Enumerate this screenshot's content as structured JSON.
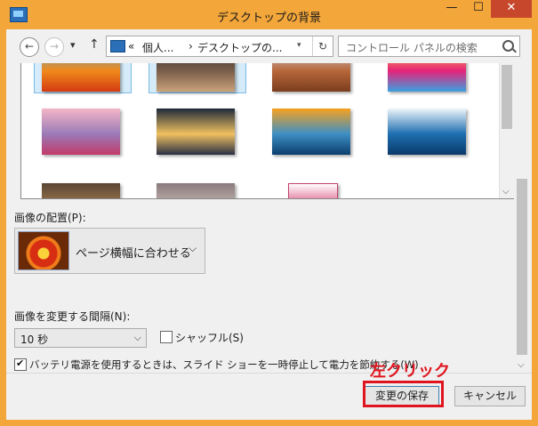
{
  "window": {
    "title": "デスクトップの背景",
    "minimize": "—",
    "maximize": "☐",
    "close": "✕"
  },
  "nav": {
    "back": "←",
    "forward": "→",
    "recent": "▾",
    "up": "↑",
    "address_prefix": "«",
    "crumb1": "個人...",
    "sep": "›",
    "crumb2": "デスクトップの...",
    "address_dropdown": "▾",
    "refresh": "↻",
    "search_placeholder": "コントロール パネルの検索"
  },
  "thumbnails": [
    {
      "name": "orange-flowers",
      "selected": true,
      "colors": [
        "#5aa7d8",
        "#f08a1a",
        "#d43a12"
      ]
    },
    {
      "name": "dark-bokeh",
      "selected": true,
      "colors": [
        "#2d2b30",
        "#7a5e4a",
        "#c9a27a"
      ]
    },
    {
      "name": "monument-valley",
      "selected": false,
      "colors": [
        "#c9d9ee",
        "#b8673a",
        "#7a3d1e"
      ]
    },
    {
      "name": "rainbow-swirl",
      "selected": false,
      "colors": [
        "#f9d63a",
        "#e6237a",
        "#3aa0e0"
      ]
    },
    {
      "name": "tulip-field",
      "selected": false,
      "colors": [
        "#f4b6c6",
        "#9a7bb8",
        "#c23a6a"
      ]
    },
    {
      "name": "city-lights-bokeh",
      "selected": false,
      "colors": [
        "#1e2a3a",
        "#f0c060",
        "#2a2f45"
      ]
    },
    {
      "name": "sunset-sea",
      "selected": false,
      "colors": [
        "#f7a21e",
        "#3e8fc4",
        "#0b3e6e"
      ]
    },
    {
      "name": "surfer-wave",
      "selected": false,
      "colors": [
        "#eef6fb",
        "#1e6eb0",
        "#0a3a6a"
      ]
    },
    {
      "name": "cat-face",
      "selected": false,
      "colors": [
        "#5a4634",
        "#a67c52",
        "#2a2018"
      ]
    },
    {
      "name": "blurry-dusk",
      "selected": false,
      "colors": [
        "#8a7b80",
        "#c9b8b0",
        "#4a3e44"
      ]
    },
    {
      "name": "menu-screenshot",
      "selected": false,
      "colors": [
        "#ffffff",
        "#d94a7a",
        "#f4eef4"
      ]
    }
  ],
  "position": {
    "label": "画像の配置(P):",
    "value": "ページ横幅に合わせる",
    "arrow": "⌵"
  },
  "interval": {
    "label": "画像を変更する間隔(N):",
    "value": "10 秒",
    "arrow": "⌵",
    "shuffle_label": "シャッフル(S)",
    "shuffle_checked": false
  },
  "battery": {
    "label": "バッテリ電源を使用するときは、スライド ショーを一時停止して電力を節約する(W)",
    "checked": true
  },
  "buttons": {
    "save": "変更の保存",
    "cancel": "キャンセル"
  },
  "annotation": {
    "text": "左クリック",
    "color": "#e0141e"
  },
  "scroll": {
    "down": "⌵"
  }
}
